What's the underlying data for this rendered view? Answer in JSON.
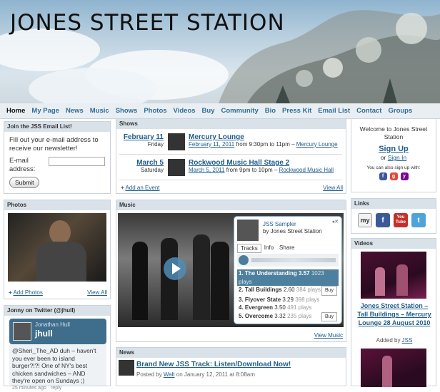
{
  "site": {
    "title": "JONES STREET STATION"
  },
  "nav": [
    "Home",
    "My Page",
    "News",
    "Music",
    "Shows",
    "Photos",
    "Videos",
    "Buy",
    "Community",
    "Bio",
    "Press Kit",
    "Email List",
    "Contact",
    "Groups"
  ],
  "email_list": {
    "header": "Join the JSS Email List!",
    "intro": "Fill out your e-mail address to receive our newsletter!",
    "label": "E-mail address:",
    "submit": "Submit"
  },
  "photos": {
    "header": "Photos",
    "add": "Add Photos",
    "view_all": "View All"
  },
  "twitter": {
    "header": "Jonny on Twitter (@jhull)",
    "name": "Jonathan Hull",
    "handle": "jhull",
    "tweet": "@Sheri_The_AD duh – haven't you ever been to island burger?!?! One of NY's best chicken sandwiches – AND they're open on Sundays ;)",
    "meta": "25 minutes ago · reply"
  },
  "shows": {
    "header": "Shows",
    "items": [
      {
        "date": "February 11",
        "day": "Friday",
        "title": "Mercury Lounge",
        "when": "February 11, 2011",
        "detail": " from 9:30pm to 11pm – ",
        "venue": "Mercury Lounge"
      },
      {
        "date": "March 5",
        "day": "Saturday",
        "title": "Rockwood Music Hall Stage 2",
        "when": "March 5, 2011",
        "detail": " from 9pm to 10pm – ",
        "venue": "Rockwood Music Hall"
      }
    ],
    "add": "Add an Event",
    "view_all": "View All"
  },
  "music": {
    "header": "Music",
    "player_title": "JSS Sampler",
    "player_by": "by Jones Street Station",
    "tabs": [
      "Tracks",
      "Info",
      "Share"
    ],
    "tracks": [
      {
        "n": "1. The Understanding",
        "len": "3.57",
        "plays": "1023 plays"
      },
      {
        "n": "2. Tall Buildings",
        "len": "2.60",
        "plays": "384 plays"
      },
      {
        "n": "3. Flyover State",
        "len": "3.29",
        "plays": "398 plays"
      },
      {
        "n": "4. Evergreen",
        "len": "3.50",
        "plays": "491 plays"
      },
      {
        "n": "5. Overcome",
        "len": "3.32",
        "plays": "235 plays"
      }
    ],
    "buy": "Buy",
    "view": "View Music"
  },
  "news": {
    "header": "News",
    "title": "Brand New JSS Track: Listen/Download Now!",
    "posted_prefix": "Posted by ",
    "author": "Walt",
    "posted_suffix": " on January 12, 2011 at 8:08am"
  },
  "welcome": {
    "title": "Welcome to Jones Street Station",
    "signup": "Sign Up",
    "or": "or",
    "signin": "Sign In",
    "also": "You can also sign up with:"
  },
  "links": {
    "header": "Links",
    "items": [
      "my",
      "f",
      "You Tube",
      "t"
    ]
  },
  "videos": {
    "header": "Videos",
    "title": "Jones Street Station – Tall Buildings – Mercury Lounge 28 August 2010",
    "added_prefix": "Added by ",
    "added_by": "JSS"
  },
  "colors": {
    "link": "#1f5c8a",
    "nav": "#2e6d99",
    "header_bg": "#d9e2e9"
  }
}
